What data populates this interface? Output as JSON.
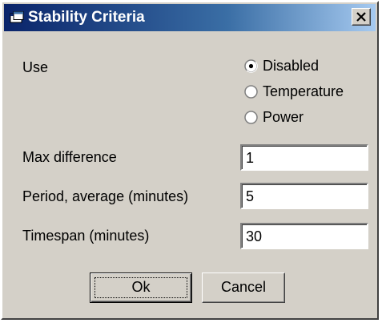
{
  "window": {
    "title": "Stability Criteria",
    "close_glyph": "X",
    "title_icon": "window-app-icon"
  },
  "use": {
    "label": "Use",
    "options": [
      {
        "label": "Disabled",
        "selected": true
      },
      {
        "label": "Temperature",
        "selected": false
      },
      {
        "label": "Power",
        "selected": false
      }
    ]
  },
  "fields": {
    "max_difference": {
      "label": "Max difference",
      "value": "1"
    },
    "period_average": {
      "label": "Period, average (minutes)",
      "value": "5"
    },
    "timespan": {
      "label": "Timespan (minutes)",
      "value": "30"
    }
  },
  "buttons": {
    "ok_label": "Ok",
    "cancel_label": "Cancel"
  },
  "colors": {
    "title_start": "#0a246a",
    "title_end": "#a6caf0",
    "face": "#d4d0c8"
  }
}
